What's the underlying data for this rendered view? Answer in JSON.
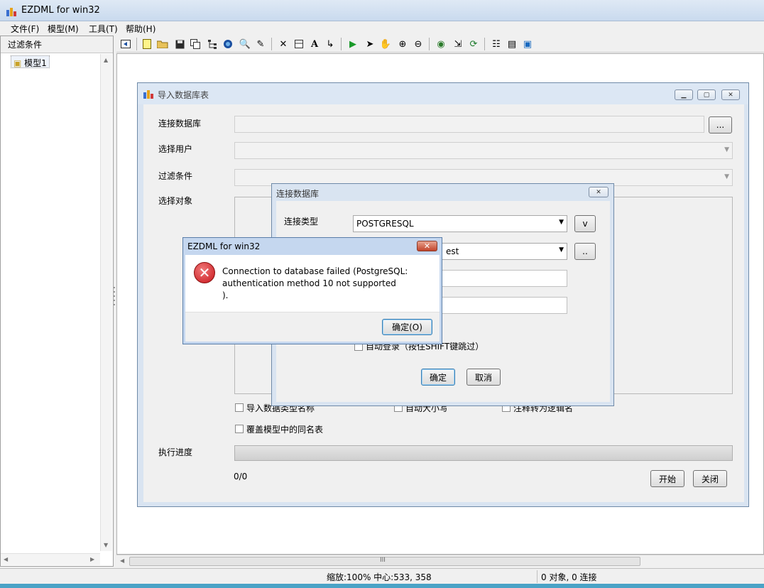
{
  "window": {
    "title": "EZDML for win32"
  },
  "menu": [
    "文件(F)",
    "模型(M)",
    "工具(T)",
    "帮助(H)"
  ],
  "left_panel": {
    "header": "过滤条件",
    "tree_items": [
      "模型1"
    ]
  },
  "statusbar": {
    "zoom": "缩放:100% 中心:533, 358",
    "counts": "0 对象, 0 连接"
  },
  "scrollbar_grip": "III",
  "import_dialog": {
    "title": "导入数据库表",
    "labels": {
      "connect_db": "连接数据库",
      "select_user": "选择用户",
      "filter": "过滤条件",
      "select_objects": "选择对象",
      "progress": "执行进度"
    },
    "browse_button": "...",
    "checkboxes": [
      "导入数据类型名称",
      "自动大小写",
      "注释转为逻辑名",
      "覆盖模型中的同名表"
    ],
    "progress_text": "0/0",
    "start_button": "开始",
    "close_button": "关闭"
  },
  "connect_dialog": {
    "title": "连接数据库",
    "label_type": "连接类型",
    "db_type": "POSTGRESQL",
    "type_button": "v",
    "db_name_visible": "est",
    "db_button": "..",
    "auto_login": "自动登录（按住SHIFT键跳过）",
    "ok_button": "确定",
    "cancel_button": "取消"
  },
  "message_box": {
    "title": "EZDML for win32",
    "message_lines": [
      "Connection to database failed (PostgreSQL:",
      "authentication method 10 not supported",
      ")."
    ],
    "ok_button": "确定(O)"
  },
  "colors": {
    "bottom_strip": "#4aa3c6",
    "error_icon": "#c8141a"
  }
}
